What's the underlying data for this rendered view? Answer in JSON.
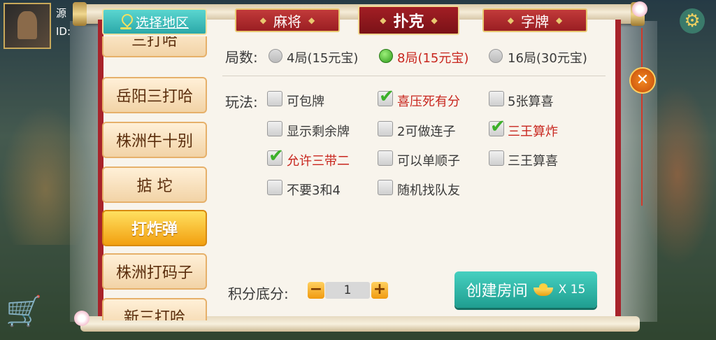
{
  "player": {
    "name": "源",
    "id_label": "ID:"
  },
  "region": {
    "label": "选择地区"
  },
  "tabs": [
    {
      "label": "麻将",
      "active": false
    },
    {
      "label": "扑克",
      "active": true
    },
    {
      "label": "字牌",
      "active": false
    }
  ],
  "categories": [
    {
      "label": "三打哈",
      "active": false
    },
    {
      "label": "岳阳三打哈",
      "active": false
    },
    {
      "label": "株洲牛十别",
      "active": false
    },
    {
      "label": "掂 坨",
      "active": false
    },
    {
      "label": "打炸弹",
      "active": true
    },
    {
      "label": "株洲打码子",
      "active": false
    },
    {
      "label": "新三打哈",
      "active": false
    }
  ],
  "rounds": {
    "label": "局数:",
    "options": [
      {
        "label": "4局(15元宝)",
        "selected": false
      },
      {
        "label": "8局(15元宝)",
        "selected": true
      },
      {
        "label": "16局(30元宝)",
        "selected": false
      }
    ]
  },
  "rules": {
    "label": "玩法:",
    "options": [
      {
        "label": "可包牌",
        "checked": false
      },
      {
        "label": "喜压死有分",
        "checked": true
      },
      {
        "label": "5张算喜",
        "checked": false
      },
      {
        "label": "显示剩余牌",
        "checked": false
      },
      {
        "label": "2可做连子",
        "checked": false
      },
      {
        "label": "三王算炸",
        "checked": true
      },
      {
        "label": "允许三带二",
        "checked": true
      },
      {
        "label": "可以单顺子",
        "checked": false
      },
      {
        "label": "三王算喜",
        "checked": false
      },
      {
        "label": "不要3和4",
        "checked": false
      },
      {
        "label": "随机找队友",
        "checked": false
      }
    ]
  },
  "score": {
    "label": "积分底分:",
    "value": "1",
    "minus": "−",
    "plus": "+"
  },
  "create": {
    "label": "创建房间",
    "cost": "X 15"
  },
  "close_symbol": "✕",
  "icons": {
    "settings": "gear-icon",
    "shop": "cart-icon",
    "close": "close-icon",
    "region": "location-pin-icon",
    "currency": "ingot-icon"
  }
}
